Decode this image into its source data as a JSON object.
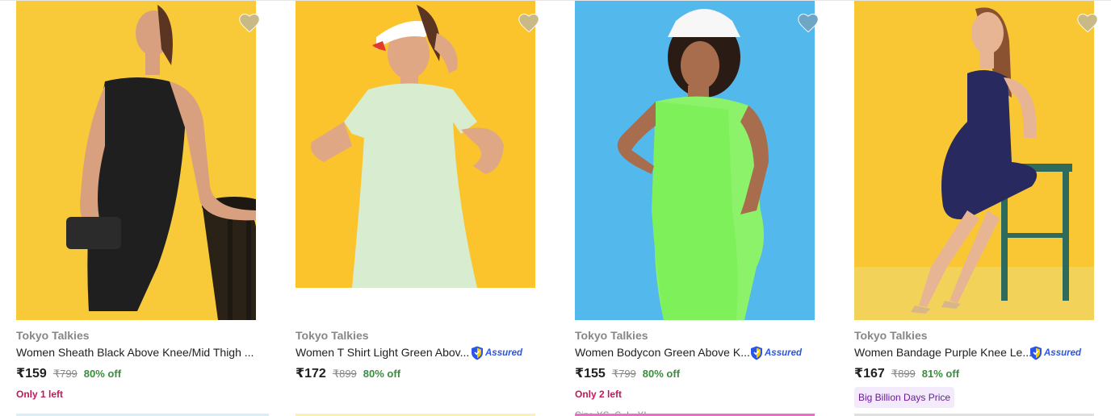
{
  "colors": {
    "accent_green": "#388e3c",
    "stock_pink": "#c2185b",
    "assured_blue": "#2a55e5",
    "bbd_purple": "#6a1b9a",
    "wishlist_grey": "#c8c0a8"
  },
  "assured_label": "Assured",
  "products": [
    {
      "brand": "Tokyo Talkies",
      "title": "Women Sheath Black Above Knee/Mid Thigh ...",
      "price": "₹159",
      "mrp": "₹799",
      "discount": "80% off",
      "stock_note": "Only 1 left",
      "assured": false,
      "image_icon": "product-photo-black-dress"
    },
    {
      "brand": "Tokyo Talkies",
      "title": "Women T Shirt Light Green Abov...",
      "price": "₹172",
      "mrp": "₹899",
      "discount": "80% off",
      "assured": true,
      "image_icon": "product-photo-green-tshirt-dress"
    },
    {
      "brand": "Tokyo Talkies",
      "title": "Women Bodycon Green Above K...",
      "price": "₹155",
      "mrp": "₹799",
      "discount": "80% off",
      "stock_note": "Only 2 left",
      "size_note": "Size XS, S, L, XL",
      "assured": true,
      "image_icon": "product-photo-neon-green-dress"
    },
    {
      "brand": "Tokyo Talkies",
      "title": "Women Bandage Purple Knee Le...",
      "price": "₹167",
      "mrp": "₹899",
      "discount": "81% off",
      "offer_badge": "Big Billion Days Price",
      "assured": true,
      "image_icon": "product-photo-purple-dress"
    }
  ]
}
